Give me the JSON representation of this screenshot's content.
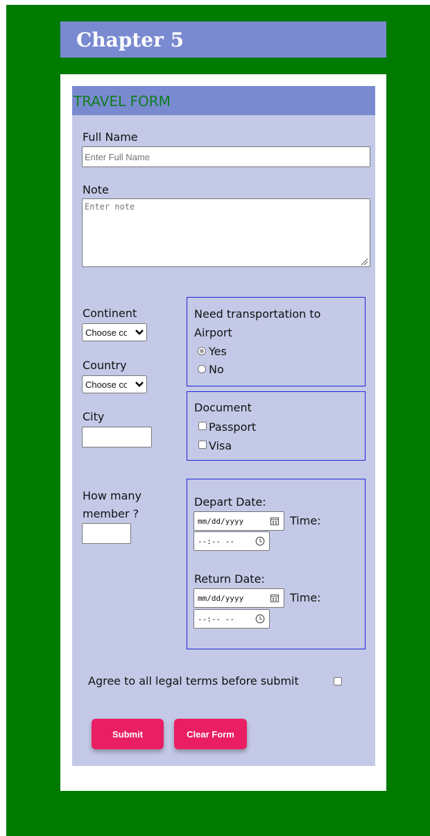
{
  "page": {
    "chapter_title": "Chapter 5"
  },
  "form": {
    "header": "TRAVEL FORM",
    "full_name": {
      "label": "Full Name",
      "placeholder": "Enter Full Name",
      "value": ""
    },
    "note": {
      "label": "Note",
      "placeholder": "Enter note",
      "value": ""
    },
    "continent": {
      "label": "Continent",
      "selected": "Choose continent"
    },
    "country": {
      "label": "Country",
      "selected": "Choose country"
    },
    "city": {
      "label": "City",
      "value": ""
    },
    "members": {
      "label_line1": "How many",
      "label_line2": "member ?",
      "value": ""
    },
    "transport": {
      "label_line1": "Need transportation to",
      "label_line2": "Airport",
      "options": [
        {
          "label": "Yes",
          "checked": true
        },
        {
          "label": "No",
          "checked": false
        }
      ]
    },
    "document": {
      "label": "Document",
      "options": [
        {
          "label": "Passport",
          "checked": false
        },
        {
          "label": "Visa",
          "checked": false
        }
      ]
    },
    "depart": {
      "label": "Depart Date:",
      "date_placeholder": "mm/dd/yyyy",
      "time_label": "Time:",
      "time_placeholder": "--:-- --"
    },
    "return": {
      "label": "Return Date:",
      "date_placeholder": "mm/dd/yyyy",
      "time_label": "Time:",
      "time_placeholder": "--:-- --"
    },
    "agree": {
      "label": "Agree to all legal terms before submit",
      "checked": false
    },
    "buttons": {
      "submit": "Submit",
      "clear": "Clear Form"
    }
  },
  "colors": {
    "background": "#017a00",
    "header_bar": "#7a8ad0",
    "panel": "#c4c9e7",
    "accent_button": "#e91e63",
    "box_border": "#1a24d6",
    "form_title": "#0e7d1e"
  }
}
